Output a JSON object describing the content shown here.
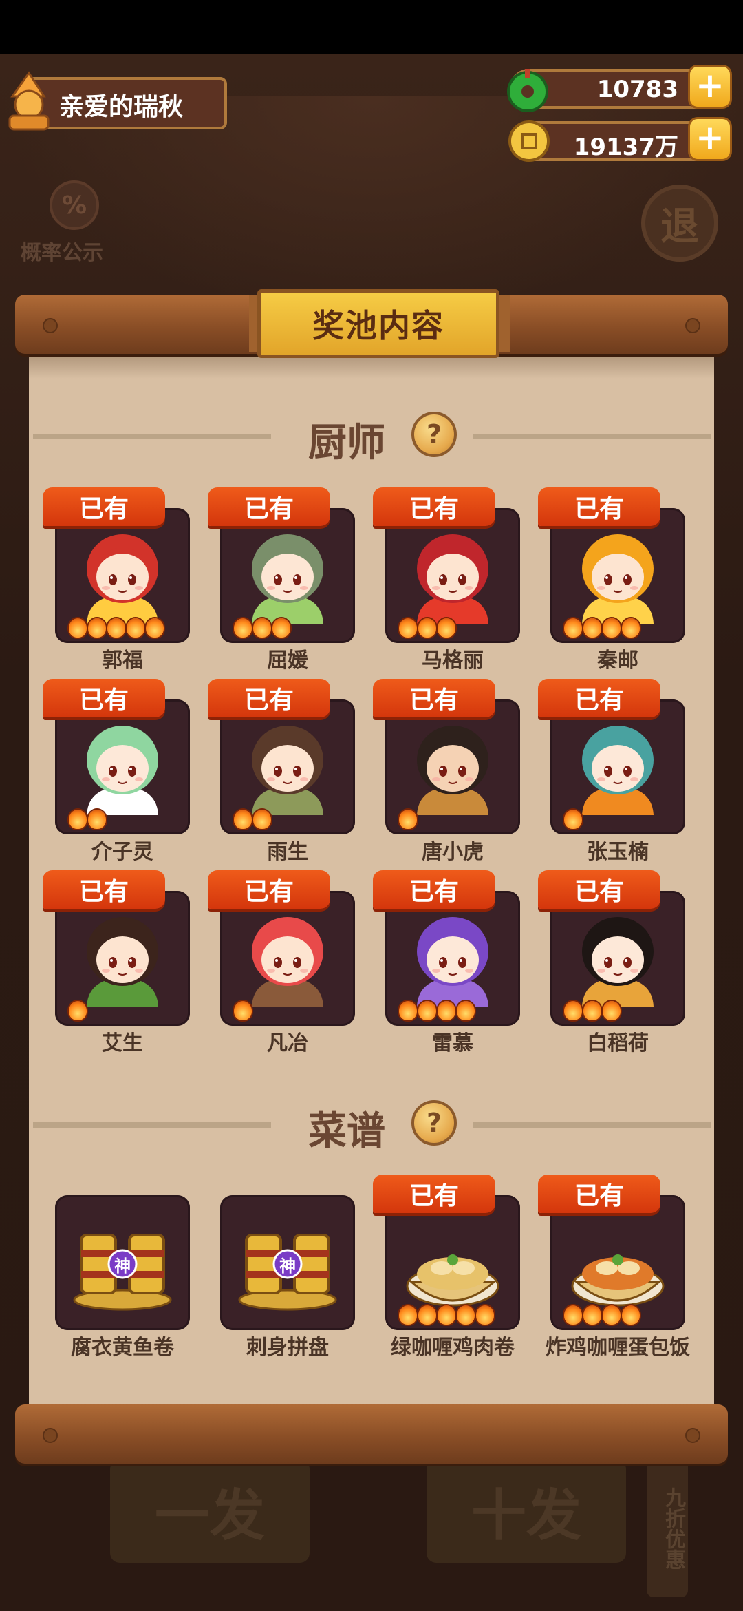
{
  "player": {
    "name": "亲爱的瑞秋"
  },
  "currency": {
    "jade": "10783",
    "coins": "19137万"
  },
  "probability_label": "概率公示",
  "exit_label": "退",
  "panel_title": "奖池内容",
  "sections": {
    "chef": {
      "title": "厨师"
    },
    "recipe": {
      "title": "菜谱"
    }
  },
  "have_label": "已有",
  "dish_badge": "神",
  "chefs": [
    {
      "name": "郭福",
      "owned": true,
      "stars": 5,
      "hair": "#d2332a",
      "skin": "#fde4d0",
      "accent": "#ffcc40"
    },
    {
      "name": "屈媛",
      "owned": true,
      "stars": 3,
      "hair": "#7a8f6a",
      "skin": "#fde6d4",
      "accent": "#9ccf6a"
    },
    {
      "name": "马格丽",
      "owned": true,
      "stars": 3,
      "hair": "#c0262c",
      "skin": "#fde4d0",
      "accent": "#e53a2a"
    },
    {
      "name": "秦邮",
      "owned": true,
      "stars": 4,
      "hair": "#f4a41c",
      "skin": "#fde4d0",
      "accent": "#ffd24a"
    },
    {
      "name": "介子灵",
      "owned": true,
      "stars": 2,
      "hair": "#8fd6a0",
      "skin": "#fde8d8",
      "accent": "#ffffff"
    },
    {
      "name": "雨生",
      "owned": true,
      "stars": 2,
      "hair": "#5a3a2a",
      "skin": "#fde4d0",
      "accent": "#8d9a5a"
    },
    {
      "name": "唐小虎",
      "owned": true,
      "stars": 1,
      "hair": "#2e211c",
      "skin": "#f5d2b4",
      "accent": "#c98a3a"
    },
    {
      "name": "张玉楠",
      "owned": true,
      "stars": 1,
      "hair": "#49a2a0",
      "skin": "#fde8d8",
      "accent": "#f08a20"
    },
    {
      "name": "艾生",
      "owned": true,
      "stars": 1,
      "hair": "#3c241c",
      "skin": "#fde4d0",
      "accent": "#5a9a3a"
    },
    {
      "name": "凡冶",
      "owned": true,
      "stars": 1,
      "hair": "#e84a4a",
      "skin": "#fde4d0",
      "accent": "#8a5a3a"
    },
    {
      "name": "雷慕",
      "owned": true,
      "stars": 4,
      "hair": "#7a48c6",
      "skin": "#fde8d8",
      "accent": "#9a6ad8"
    },
    {
      "name": "白稻荷",
      "owned": true,
      "stars": 3,
      "hair": "#1e1614",
      "skin": "#fde8d8",
      "accent": "#e8a43a"
    }
  ],
  "recipes": [
    {
      "name": "腐衣黄鱼卷",
      "owned": false,
      "stars": 0,
      "type": "mystery",
      "color": "#e8b83a"
    },
    {
      "name": "刺身拼盘",
      "owned": false,
      "stars": 0,
      "type": "mystery",
      "color": "#e8b83a"
    },
    {
      "name": "绿咖喱鸡肉卷",
      "owned": true,
      "stars": 5,
      "type": "dish",
      "color": "#e7c26a"
    },
    {
      "name": "炸鸡咖喱蛋包饭",
      "owned": true,
      "stars": 4,
      "type": "dish",
      "color": "#e07a2a"
    }
  ],
  "bottom": {
    "single": "一发",
    "ten": "十发",
    "discount": "九折优惠"
  }
}
